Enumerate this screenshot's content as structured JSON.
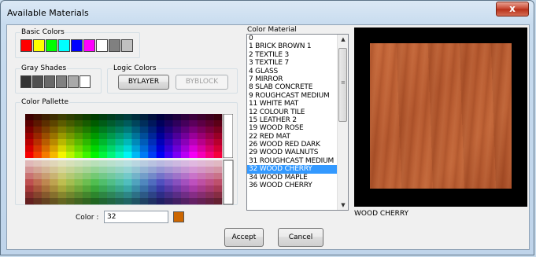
{
  "window": {
    "title": "Available Materials",
    "close_label": "x"
  },
  "basic_colors": {
    "label": "Basic Colors",
    "swatches": [
      "#ff0000",
      "#ffff00",
      "#00ff00",
      "#00ffff",
      "#0000ff",
      "#ff00ff",
      "#ffffff",
      "#808080",
      "#c0c0c0"
    ]
  },
  "gray_shades": {
    "label": "Gray Shades",
    "swatches": [
      "#333333",
      "#505050",
      "#696969",
      "#808080",
      "#a9a9a9",
      "#ffffff"
    ]
  },
  "logic_colors": {
    "label": "Logic Colors",
    "bylayer": "BYLAYER",
    "byblock": "BYBLOCK"
  },
  "color_pallette": {
    "label": "Color Pallette"
  },
  "color_material": {
    "label": "Color Material",
    "items": [
      "0",
      "1 BRICK BROWN 1",
      "2 TEXTILE 3",
      "3 TEXTILE 7",
      "4 GLASS",
      "7 MIRROR",
      "8 SLAB CONCRETE",
      "9 ROUGHCAST MEDIUM",
      "11 WHITE MAT",
      "12 COLOUR TILE",
      "15 LEATHER 2",
      "19 WOOD ROSE",
      "22 RED MAT",
      "26 WOOD RED DARK",
      "29 WOOD WALNUTS",
      "31 ROUGHCAST MEDIUM",
      "32 WOOD CHERRY",
      "34 WOOD MAPLE",
      "36 WOOD CHERRY"
    ],
    "selected_index": 16
  },
  "preview": {
    "caption": "WOOD CHERRY"
  },
  "color_field": {
    "label": "Color :",
    "value": "32",
    "swatch_color": "#cc6600"
  },
  "buttons": {
    "accept": "Accept",
    "cancel": "Cancel"
  }
}
